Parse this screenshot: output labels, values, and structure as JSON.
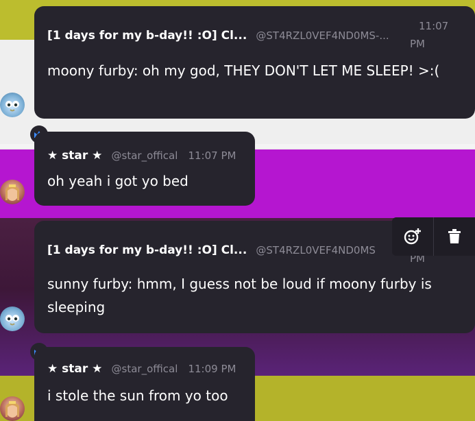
{
  "messages": [
    {
      "author": "[1 days for my b-day!! :O] Cl...",
      "handle": "@ST4RZL0VEF4ND0MS-...",
      "time_line1": "11:07",
      "time_line2": "PM",
      "text": "moony furby: oh my god, THEY DON'T LET ME SLEEP! >:("
    },
    {
      "author": "★ star ★",
      "handle": "@star_offical",
      "time": "11:07 PM",
      "text": "oh yeah i got yo bed"
    },
    {
      "author": "[1 days for my b-day!! :O] Cl...",
      "handle": "@ST4RZL0VEF4ND0MS",
      "time_line2": "PM",
      "text": "sunny furby: hmm, I guess not be loud if moony furby is sleeping"
    },
    {
      "author": "★ star ★",
      "handle": "@star_offical",
      "time": "11:09 PM",
      "text": "i stole the sun from yo too"
    }
  ],
  "toolbar": {
    "react_icon": "add-reaction-icon",
    "delete_icon": "trash-icon"
  },
  "colors": {
    "bubble": "#26242d",
    "badge_blue": "#3d8cff",
    "muted": "#8d8b96"
  }
}
